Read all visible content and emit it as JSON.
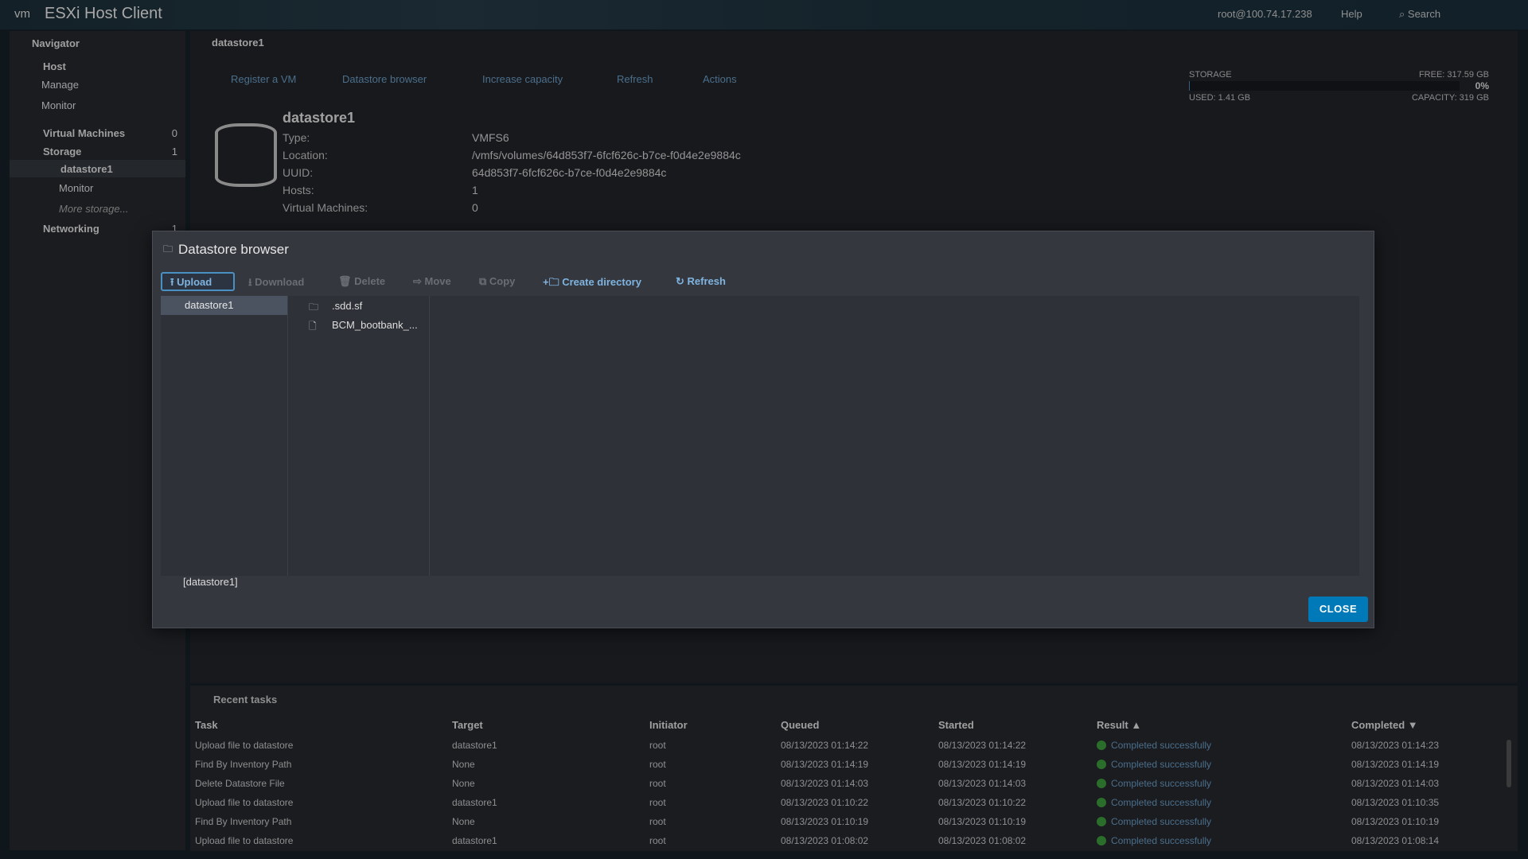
{
  "header": {
    "logo": "vm",
    "title": "ESXi Host Client",
    "user": "root@100.74.17.238",
    "help": "Help",
    "search": "Search"
  },
  "navigator": {
    "title": "Navigator",
    "items": [
      {
        "label": "Host"
      },
      {
        "label": "Manage"
      },
      {
        "label": "Monitor"
      },
      {
        "label": "Virtual Machines",
        "count": "0"
      },
      {
        "label": "Storage",
        "count": "1"
      },
      {
        "label": "datastore1"
      },
      {
        "label": "Monitor"
      },
      {
        "label": "More storage..."
      },
      {
        "label": "Networking",
        "count": "1"
      }
    ]
  },
  "main": {
    "breadcrumb": "datastore1",
    "actions": [
      "Register a VM",
      "Datastore browser",
      "Increase capacity",
      "Refresh",
      "Actions"
    ],
    "name": "datastore1",
    "props": [
      {
        "label": "Type:",
        "value": "VMFS6"
      },
      {
        "label": "Location:",
        "value": "/vmfs/volumes/64d853f7-6fcf626c-b7ce-f0d4e2e9884c"
      },
      {
        "label": "UUID:",
        "value": "64d853f7-6fcf626c-b7ce-f0d4e2e9884c"
      },
      {
        "label": "Hosts:",
        "value": "1"
      },
      {
        "label": "Virtual Machines:",
        "value": "0"
      }
    ],
    "storage": {
      "label": "STORAGE",
      "free": "FREE: 317.59 GB",
      "percent": "0%",
      "used": "USED: 1.41 GB",
      "capacity": "CAPACITY: 319 GB",
      "used_fraction": 0.0044
    }
  },
  "dialog": {
    "title": "Datastore browser",
    "toolbar": {
      "upload": "Upload",
      "download": "Download",
      "delete": "Delete",
      "move": "Move",
      "copy": "Copy",
      "create": "Create directory",
      "refresh": "Refresh"
    },
    "tree": [
      "datastore1"
    ],
    "files": [
      {
        "name": ".sdd.sf",
        "icon": "folder-icon"
      },
      {
        "name": "BCM_bootbank_...",
        "icon": "file-icon"
      }
    ],
    "path": "[datastore1]",
    "close": "CLOSE"
  },
  "tasks": {
    "title": "Recent tasks",
    "columns": [
      "Task",
      "Target",
      "Initiator",
      "Queued",
      "Started",
      "Result ▲",
      "Completed ▼"
    ],
    "rows": [
      [
        "Upload file to datastore",
        "datastore1",
        "root",
        "08/13/2023 01:14:22",
        "08/13/2023 01:14:22",
        "Completed successfully",
        "08/13/2023 01:14:23"
      ],
      [
        "Find By Inventory Path",
        "None",
        "root",
        "08/13/2023 01:14:19",
        "08/13/2023 01:14:19",
        "Completed successfully",
        "08/13/2023 01:14:19"
      ],
      [
        "Delete Datastore File",
        "None",
        "root",
        "08/13/2023 01:14:03",
        "08/13/2023 01:14:03",
        "Completed successfully",
        "08/13/2023 01:14:03"
      ],
      [
        "Upload file to datastore",
        "datastore1",
        "root",
        "08/13/2023 01:10:22",
        "08/13/2023 01:10:22",
        "Completed successfully",
        "08/13/2023 01:10:35"
      ],
      [
        "Find By Inventory Path",
        "None",
        "root",
        "08/13/2023 01:10:19",
        "08/13/2023 01:10:19",
        "Completed successfully",
        "08/13/2023 01:10:19"
      ],
      [
        "Upload file to datastore",
        "datastore1",
        "root",
        "08/13/2023 01:08:02",
        "08/13/2023 01:08:02",
        "Completed successfully",
        "08/13/2023 01:08:14"
      ]
    ]
  }
}
